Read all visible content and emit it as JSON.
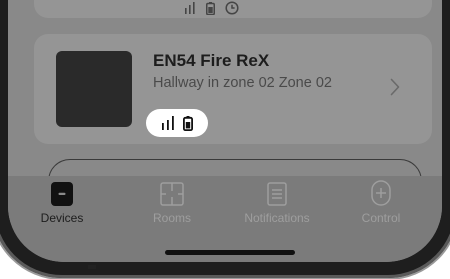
{
  "device_card": {
    "name": "EN54 Fire ReX",
    "location": "Hallway in zone 02 Zone 02",
    "status_icons": [
      "signal-strength-icon",
      "battery-icon"
    ]
  },
  "previous_card": {
    "status_icons": [
      "signal-strength-icon",
      "battery-icon",
      "clock-icon"
    ]
  },
  "tabbar": {
    "tabs": [
      {
        "label": "Devices",
        "icon": "devices-icon",
        "active": true
      },
      {
        "label": "Rooms",
        "icon": "rooms-icon",
        "active": false
      },
      {
        "label": "Notifications",
        "icon": "notifications-icon",
        "active": false
      },
      {
        "label": "Control",
        "icon": "control-icon",
        "active": false
      }
    ]
  },
  "colors": {
    "screen_dim": "#898989",
    "card": "#959595",
    "pill": "#ffffff",
    "text_primary": "#1d1d1d",
    "text_inactive": "#9e9e9e"
  }
}
